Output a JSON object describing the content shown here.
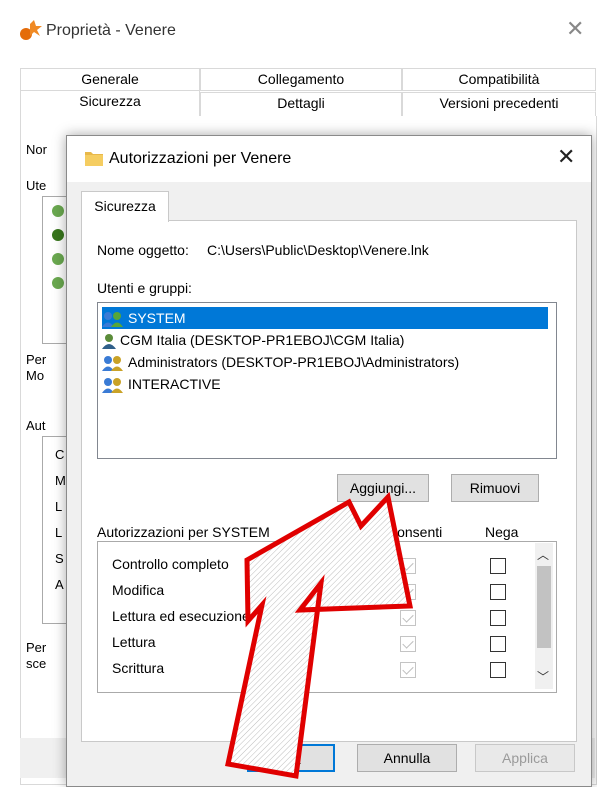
{
  "outer": {
    "title": "Proprietà - Venere",
    "tabs_row1": [
      "Generale",
      "Collegamento",
      "Compatibilità"
    ],
    "tabs_row2": [
      "Sicurezza",
      "Dettagli",
      "Versioni precedenti"
    ],
    "peek_nome": "Nor",
    "peek_ute": "Ute",
    "peek_per1": "Per",
    "peek_mo": "Mo",
    "peek_aut": "Aut",
    "peek_per2": "Per",
    "peek_sce": "sce",
    "peek_list": [
      "C",
      "M",
      "L",
      "L",
      "S",
      "A"
    ]
  },
  "dialog": {
    "title": "Autorizzazioni per Venere",
    "tab": "Sicurezza",
    "object_label": "Nome oggetto:",
    "object_path": "C:\\Users\\Public\\Desktop\\Venere.lnk",
    "groups_label": "Utenti e gruppi:",
    "users": [
      {
        "name": "SYSTEM",
        "selected": true,
        "icon": "group-users-icon"
      },
      {
        "name": "CGM Italia (DESKTOP-PR1EBOJ\\CGM Italia)",
        "selected": false,
        "icon": "single-user-icon"
      },
      {
        "name": "Administrators (DESKTOP-PR1EBOJ\\Administrators)",
        "selected": false,
        "icon": "group-users-icon"
      },
      {
        "name": "INTERACTIVE",
        "selected": false,
        "icon": "group-users-icon"
      }
    ],
    "add_button": "Aggiungi...",
    "remove_button": "Rimuovi",
    "perm_header": "Autorizzazioni per SYSTEM",
    "allow_header": "Consenti",
    "deny_header": "Nega",
    "permissions": [
      {
        "name": "Controllo completo",
        "allow": true,
        "deny": false
      },
      {
        "name": "Modifica",
        "allow": true,
        "deny": false
      },
      {
        "name": "Lettura ed esecuzione",
        "allow": true,
        "deny": false
      },
      {
        "name": "Lettura",
        "allow": true,
        "deny": false
      },
      {
        "name": "Scrittura",
        "allow": true,
        "deny": false
      }
    ],
    "ok_button": "OK",
    "cancel_button": "Annulla",
    "apply_button": "Applica"
  },
  "colors": {
    "selection": "#0078d7",
    "annotation_arrow": "#e00000"
  }
}
